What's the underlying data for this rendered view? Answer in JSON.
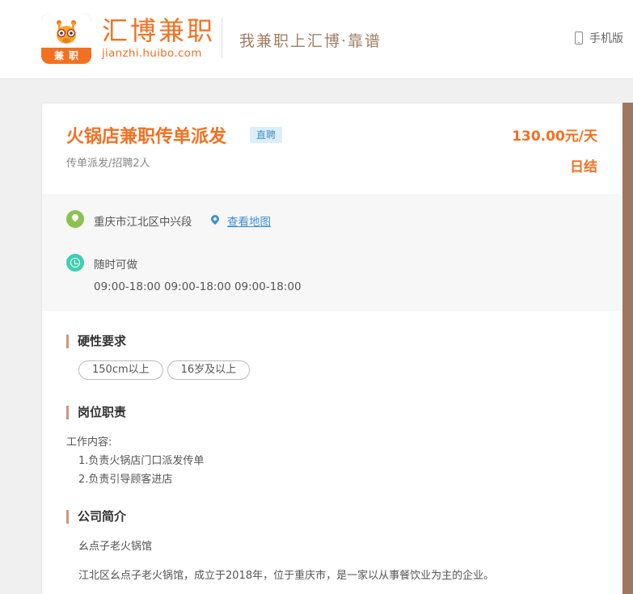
{
  "header": {
    "logo_badge": "兼职",
    "brand_cn": "汇博兼职",
    "brand_en": "jianzhi.huibo.com",
    "slogan": "我兼职上汇博·靠谱",
    "mobile_label": "手机版"
  },
  "job": {
    "title": "火锅店兼职传单派发",
    "badge": "直聘",
    "subinfo": "传单派发/招聘2人",
    "salary": "130.00元/天",
    "settlement": "日结"
  },
  "info": {
    "location": "重庆市江北区中兴段",
    "map_link": "查看地图",
    "time_label": "随时可做",
    "time_ranges": "09:00-18:00 09:00-18:00 09:00-18:00"
  },
  "requirements": {
    "title": "硬性要求",
    "tags": [
      "150cm以上",
      "16岁及以上"
    ]
  },
  "duties": {
    "title": "岗位职责",
    "heading": "工作内容:",
    "items": [
      "1.负责火锅店门口派发传单",
      "2.负责引导顾客进店"
    ]
  },
  "company": {
    "title": "公司简介",
    "name": "幺点子老火锅馆",
    "description": "江北区幺点子老火锅馆，成立于2018年，位于重庆市，是一家以从事餐饮业为主的企业。"
  },
  "colors": {
    "accent": "#f37021",
    "section_bar": "#c39a7f",
    "link": "#3d8fd6"
  }
}
